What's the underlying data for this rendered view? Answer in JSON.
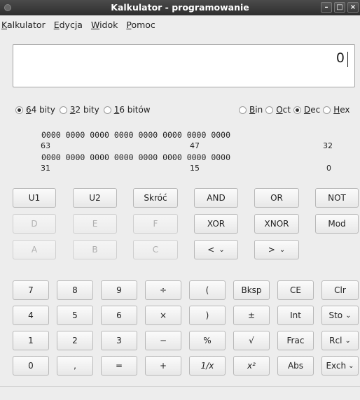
{
  "window": {
    "title": "Kalkulator - programowanie",
    "buttons": {
      "minimize": "–",
      "maximize": "□",
      "close": "×"
    }
  },
  "menu": [
    {
      "label": "Kalkulator",
      "accel": "K",
      "rest": "alkulator"
    },
    {
      "label": "Edycja",
      "accel": "E",
      "rest": "dycja"
    },
    {
      "label": "Widok",
      "accel": "W",
      "rest": "idok"
    },
    {
      "label": "Pomoc",
      "accel": "P",
      "rest": "omoc"
    }
  ],
  "display": {
    "value": "0"
  },
  "word_size": {
    "options": [
      {
        "accel": "6",
        "rest": "4 bity",
        "selected": true
      },
      {
        "accel": "3",
        "rest": "2 bity",
        "selected": false
      },
      {
        "accel": "1",
        "rest": "6 bitów",
        "selected": false
      }
    ]
  },
  "base": {
    "options": [
      {
        "accel": "B",
        "rest": "in",
        "selected": false
      },
      {
        "accel": "O",
        "rest": "ct",
        "selected": false
      },
      {
        "accel": "D",
        "rest": "ec",
        "selected": true
      },
      {
        "accel": "H",
        "rest": "ex",
        "selected": false
      }
    ]
  },
  "bit_display": {
    "row1": "0000 0000 0000 0000 0000 0000 0000 0000",
    "row2": "0000 0000 0000 0000 0000 0000 0000 0000",
    "labels_row1": [
      "63",
      "47",
      "32"
    ],
    "labels_row2": [
      "31",
      "15",
      "0"
    ]
  },
  "programming_buttons": [
    {
      "label": "U1",
      "enabled": true
    },
    {
      "label": "U2",
      "enabled": true
    },
    {
      "label": "Skróć",
      "enabled": true
    },
    {
      "label": "AND",
      "enabled": true
    },
    {
      "label": "OR",
      "enabled": true
    },
    {
      "label": "NOT",
      "enabled": true
    },
    {
      "label": "D",
      "enabled": false
    },
    {
      "label": "E",
      "enabled": false
    },
    {
      "label": "F",
      "enabled": false
    },
    {
      "label": "XOR",
      "enabled": true
    },
    {
      "label": "XNOR",
      "enabled": true
    },
    {
      "label": "Mod",
      "enabled": true
    },
    {
      "label": "A",
      "enabled": false
    },
    {
      "label": "B",
      "enabled": false
    },
    {
      "label": "C",
      "enabled": false
    },
    {
      "label": "<",
      "enabled": true,
      "dropdown": true
    },
    {
      "label": ">",
      "enabled": true,
      "dropdown": true
    }
  ],
  "keypad": [
    {
      "label": "7"
    },
    {
      "label": "8"
    },
    {
      "label": "9"
    },
    {
      "label": "÷"
    },
    {
      "label": "("
    },
    {
      "label": "Bksp"
    },
    {
      "label": "CE"
    },
    {
      "label": "Clr"
    },
    {
      "label": "4"
    },
    {
      "label": "5"
    },
    {
      "label": "6"
    },
    {
      "label": "×"
    },
    {
      "label": ")"
    },
    {
      "label": "±"
    },
    {
      "label": "Int"
    },
    {
      "label": "Sto",
      "dropdown": true
    },
    {
      "label": "1"
    },
    {
      "label": "2"
    },
    {
      "label": "3"
    },
    {
      "label": "−"
    },
    {
      "label": "%"
    },
    {
      "label": "√"
    },
    {
      "label": "Frac"
    },
    {
      "label": "Rcl",
      "dropdown": true
    },
    {
      "label": "0"
    },
    {
      "label": ","
    },
    {
      "label": "="
    },
    {
      "label": "+"
    },
    {
      "label": "1/x"
    },
    {
      "label": "x²"
    },
    {
      "label": "Abs"
    },
    {
      "label": "Exch",
      "dropdown": true
    }
  ],
  "dropdown_arrow": "⌄"
}
